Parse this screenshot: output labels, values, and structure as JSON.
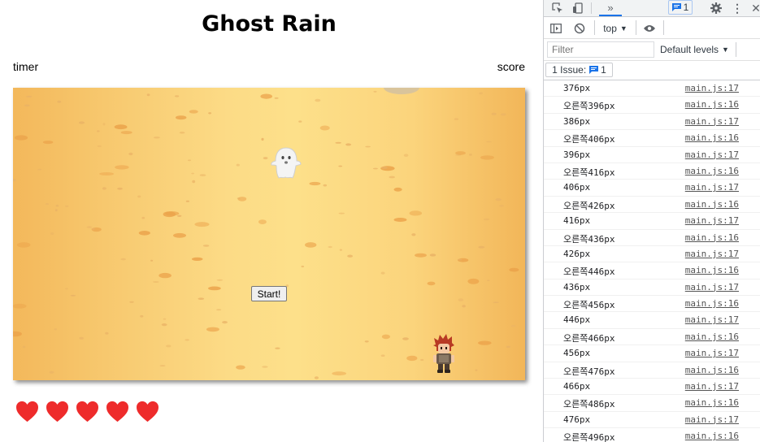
{
  "game": {
    "title": "Ghost Rain",
    "timer_label": "timer",
    "score_label": "score",
    "start_label": "Start!",
    "lives": 5,
    "heart_color": "#ee2b2b"
  },
  "devtools": {
    "context": "top",
    "filter_placeholder": "Filter",
    "levels": "Default levels",
    "message_badge": "1",
    "issues_label": "1 Issue:",
    "issues_count": "1",
    "logs": [
      {
        "msg": "376px",
        "src": "main.js:17"
      },
      {
        "msg": "오른쪽396px",
        "src": "main.js:16"
      },
      {
        "msg": "386px",
        "src": "main.js:17"
      },
      {
        "msg": "오른쪽406px",
        "src": "main.js:16"
      },
      {
        "msg": "396px",
        "src": "main.js:17"
      },
      {
        "msg": "오른쪽416px",
        "src": "main.js:16"
      },
      {
        "msg": "406px",
        "src": "main.js:17"
      },
      {
        "msg": "오른쪽426px",
        "src": "main.js:16"
      },
      {
        "msg": "416px",
        "src": "main.js:17"
      },
      {
        "msg": "오른쪽436px",
        "src": "main.js:16"
      },
      {
        "msg": "426px",
        "src": "main.js:17"
      },
      {
        "msg": "오른쪽446px",
        "src": "main.js:16"
      },
      {
        "msg": "436px",
        "src": "main.js:17"
      },
      {
        "msg": "오른쪽456px",
        "src": "main.js:16"
      },
      {
        "msg": "446px",
        "src": "main.js:17"
      },
      {
        "msg": "오른쪽466px",
        "src": "main.js:16"
      },
      {
        "msg": "456px",
        "src": "main.js:17"
      },
      {
        "msg": "오른쪽476px",
        "src": "main.js:16"
      },
      {
        "msg": "466px",
        "src": "main.js:17"
      },
      {
        "msg": "오른쪽486px",
        "src": "main.js:16"
      },
      {
        "msg": "476px",
        "src": "main.js:17"
      },
      {
        "msg": "오른쪽496px",
        "src": "main.js:16"
      }
    ]
  }
}
